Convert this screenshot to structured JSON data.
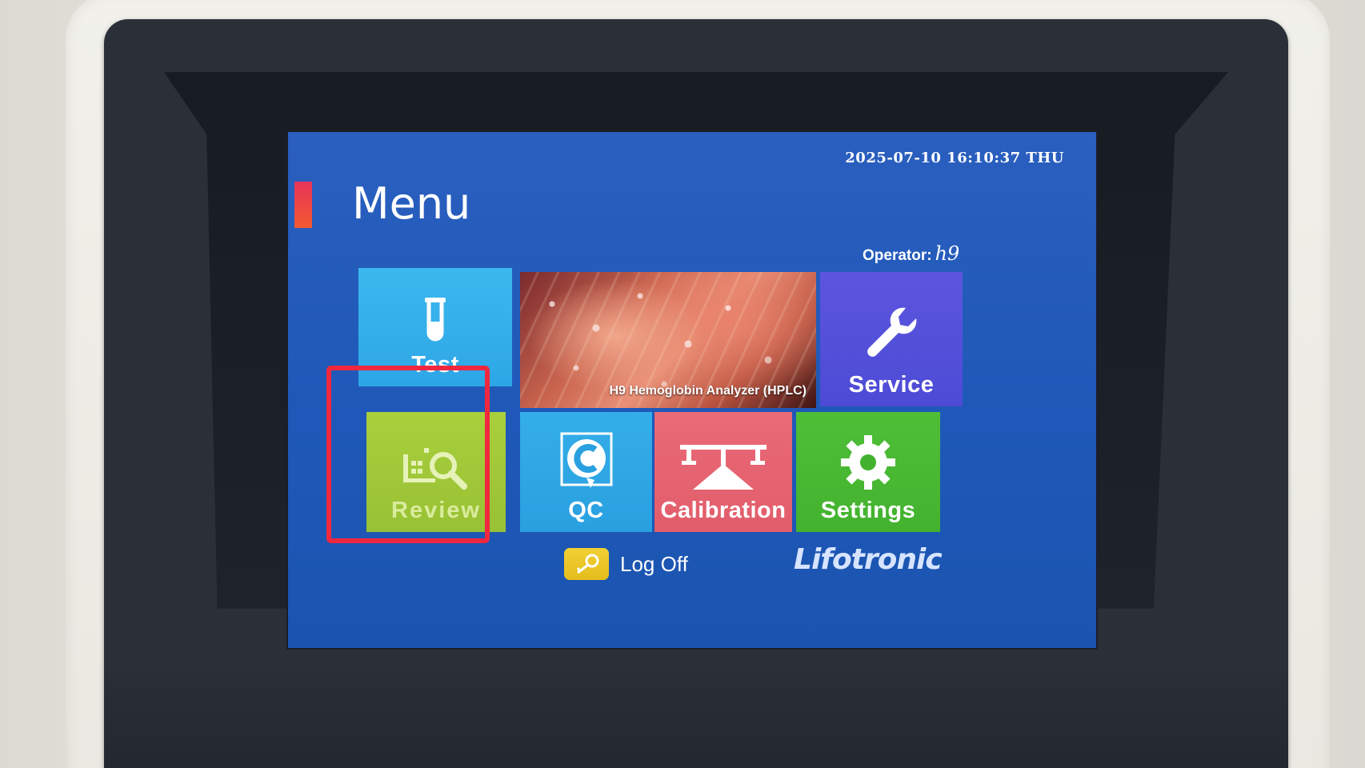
{
  "header": {
    "datetime": "2025-07-10 16:10:37 THU",
    "title": "Menu",
    "operator_label": "Operator:",
    "operator_value": "h9"
  },
  "banner": {
    "caption": "H9 Hemoglobin Analyzer (HPLC)"
  },
  "tiles": {
    "test": "Test",
    "service": "Service",
    "review": "Review",
    "qc": "QC",
    "calibration": "Calibration",
    "settings": "Settings"
  },
  "footer": {
    "logoff_label": "Log Off",
    "brand": "Lifotronic"
  },
  "colors": {
    "screen_bg": "#1f58b8",
    "test": "#2ea6e6",
    "service": "#4d4bd6",
    "review": "#98c135",
    "qc": "#2aa0e0",
    "calibration": "#e25d6b",
    "settings": "#43b22f",
    "logoff": "#e3bd1c",
    "highlight": "#f0283f",
    "accent": "#e8335b"
  },
  "icons": {
    "test": "test-tube-icon",
    "service": "wrench-icon",
    "review": "chart-magnifier-icon",
    "qc": "qc-badge-icon",
    "calibration": "balance-scale-icon",
    "settings": "gear-icon",
    "logoff": "key-icon"
  }
}
